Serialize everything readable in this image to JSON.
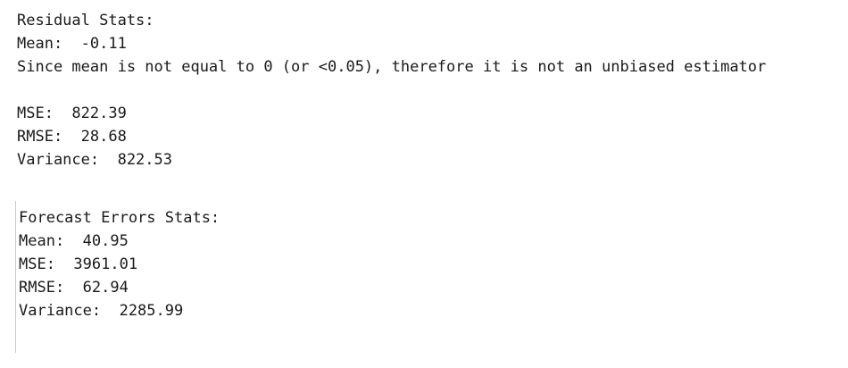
{
  "residual": {
    "heading": "Residual Stats:",
    "mean": "Mean:  -0.11",
    "note": "Since mean is not equal to 0 (or <0.05), therefore it is not an unbiased estimator",
    "mse": "MSE:  822.39",
    "rmse": "RMSE:  28.68",
    "variance": "Variance:  822.53"
  },
  "forecast": {
    "heading": "Forecast Errors Stats:",
    "mean": "Mean:  40.95",
    "mse": "MSE:  3961.01",
    "rmse": "RMSE:  62.94",
    "variance": "Variance:  2285.99"
  }
}
